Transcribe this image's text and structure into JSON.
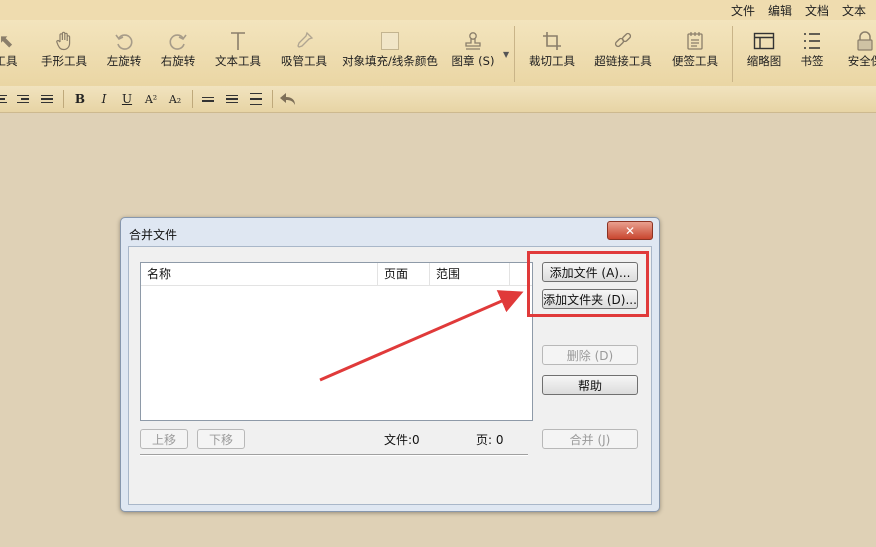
{
  "menu": [
    "文件",
    "编辑",
    "文档",
    "文本"
  ],
  "ribbon": {
    "tools": [
      {
        "label": "工具",
        "icon": "arrow-icon"
      },
      {
        "label": "手形工具",
        "icon": "hand-icon"
      },
      {
        "label": "左旋转",
        "icon": "rotate-left-icon"
      },
      {
        "label": "右旋转",
        "icon": "rotate-right-icon"
      },
      {
        "label": "文本工具",
        "icon": "text-icon"
      },
      {
        "label": "吸管工具",
        "icon": "eyedropper-icon"
      },
      {
        "label": "对象填充/线条颜色",
        "icon": "fill-color-icon"
      },
      {
        "label": "图章 (S)",
        "icon": "stamp-icon"
      },
      {
        "label": "裁切工具",
        "icon": "crop-icon"
      },
      {
        "label": "超链接工具",
        "icon": "link-icon"
      },
      {
        "label": "便签工具",
        "icon": "note-icon"
      },
      {
        "label": "缩略图",
        "icon": "thumbnail-icon"
      },
      {
        "label": "书签",
        "icon": "bookmark-icon"
      },
      {
        "label": "安全保",
        "icon": "lock-icon"
      }
    ]
  },
  "format_toolbar": {
    "bold": "B",
    "italic": "I",
    "underline": "U",
    "superscript": "A²",
    "subscript": "A₂"
  },
  "dialog": {
    "title": "合并文件",
    "close_label": "✕",
    "columns": [
      "名称",
      "页面",
      "范围"
    ],
    "add_file_label": "添加文件 (A)...",
    "add_folder_label": "添加文件夹 (D)...",
    "delete_label": "删除 (D)",
    "help_label": "帮助",
    "move_up_label": "上移",
    "move_down_label": "下移",
    "file_count_label": "文件:0",
    "page_count_label": "页: 0",
    "merge_label": "合并 (J)"
  },
  "colors": {
    "annotation": "#e03a3a",
    "workspace": "#dfd1b6"
  }
}
